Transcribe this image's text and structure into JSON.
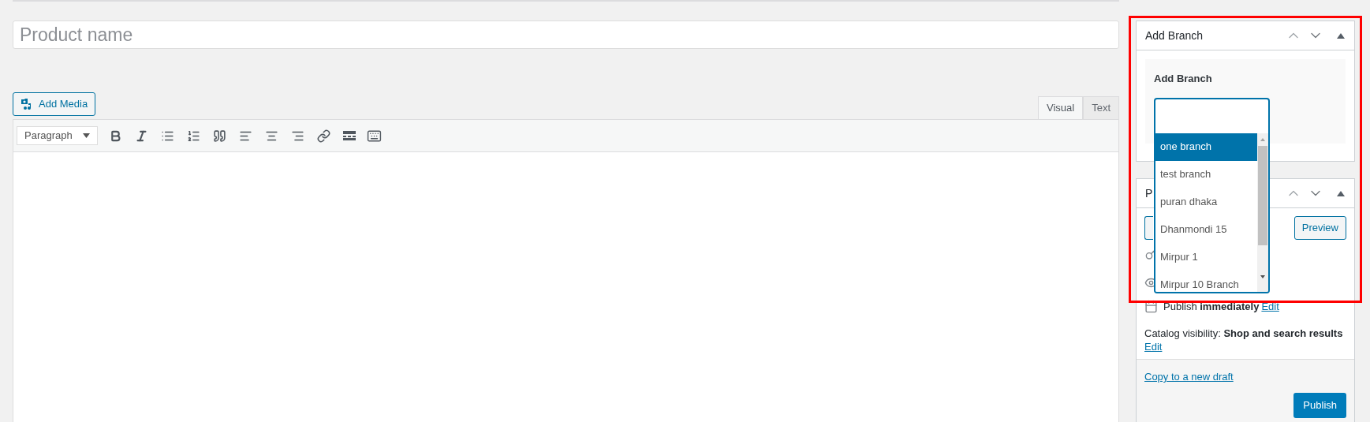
{
  "product_name": {
    "placeholder": "Product name"
  },
  "add_media": "Add Media",
  "editor_tabs": [
    {
      "label": "Visual",
      "selected": true
    },
    {
      "label": "Text",
      "selected": false
    }
  ],
  "format_select": {
    "value": "Paragraph"
  },
  "add_branch_box": {
    "title": "Add Branch",
    "label": "Add Branch",
    "options": [
      {
        "label": "one branch",
        "selected": true
      },
      {
        "label": "test branch",
        "selected": false
      },
      {
        "label": "puran dhaka",
        "selected": false
      },
      {
        "label": "Dhanmondi 15",
        "selected": false
      },
      {
        "label": "Mirpur 1",
        "selected": false
      },
      {
        "label": "Mirpur 10 Branch",
        "selected": false
      }
    ]
  },
  "publish_box": {
    "title": "P",
    "preview": "Preview",
    "schedule": "Publish **immediately**",
    "schedule_link": "Edit",
    "catalog": "Catalog visibility: **Shop and search results**",
    "catalog_link": "Edit",
    "copy_link": "Copy to a new draft",
    "publish_button": "Publish"
  }
}
